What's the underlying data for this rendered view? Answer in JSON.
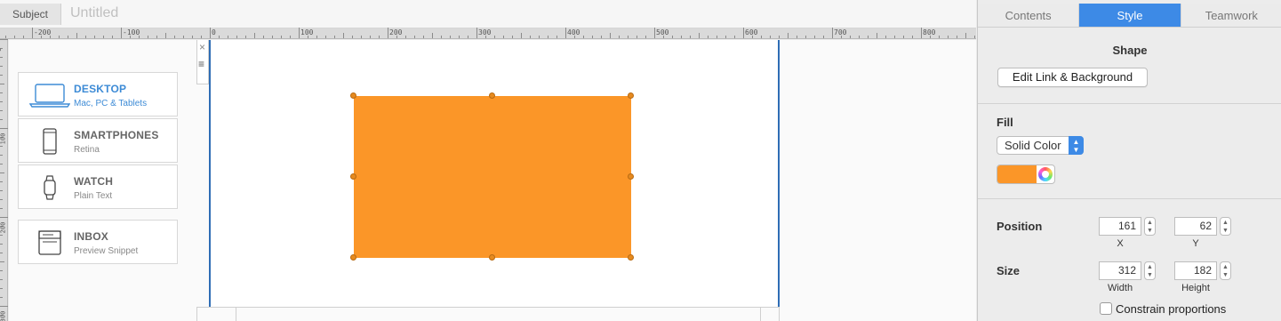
{
  "subject": {
    "label": "Subject",
    "value": "Untitled"
  },
  "ruler": {
    "h_labels": [
      "-200",
      "-100",
      "0",
      "100",
      "200",
      "300",
      "400",
      "500",
      "600",
      "700",
      "800"
    ],
    "v_labels": [
      "0",
      "100",
      "200",
      "300"
    ]
  },
  "devices": [
    {
      "title": "DESKTOP",
      "subtitle": "Mac, PC & Tablets",
      "icon": "laptop-icon",
      "active": true
    },
    {
      "title": "SMARTPHONES",
      "subtitle": "Retina",
      "icon": "smartphone-icon",
      "active": false
    },
    {
      "title": "WATCH",
      "subtitle": "Plain Text",
      "icon": "watch-icon",
      "active": false
    },
    {
      "title": "INBOX",
      "subtitle": "Preview Snippet",
      "icon": "inbox-icon",
      "active": false
    }
  ],
  "frame": {
    "close_glyph": "×",
    "menu_glyph": "≡"
  },
  "shape": {
    "color": "#fb9628"
  },
  "inspector": {
    "tabs": [
      "Contents",
      "Style",
      "Teamwork"
    ],
    "active_tab": "Style",
    "shape_title": "Shape",
    "edit_button": "Edit Link & Background",
    "fill_label": "Fill",
    "fill_type": "Solid Color",
    "fill_color": "#fb9628",
    "position_label": "Position",
    "size_label": "Size",
    "x": "161",
    "y": "62",
    "x_label": "X",
    "y_label": "Y",
    "width": "312",
    "height": "182",
    "width_label": "Width",
    "height_label": "Height",
    "constrain_label": "Constrain proportions"
  }
}
